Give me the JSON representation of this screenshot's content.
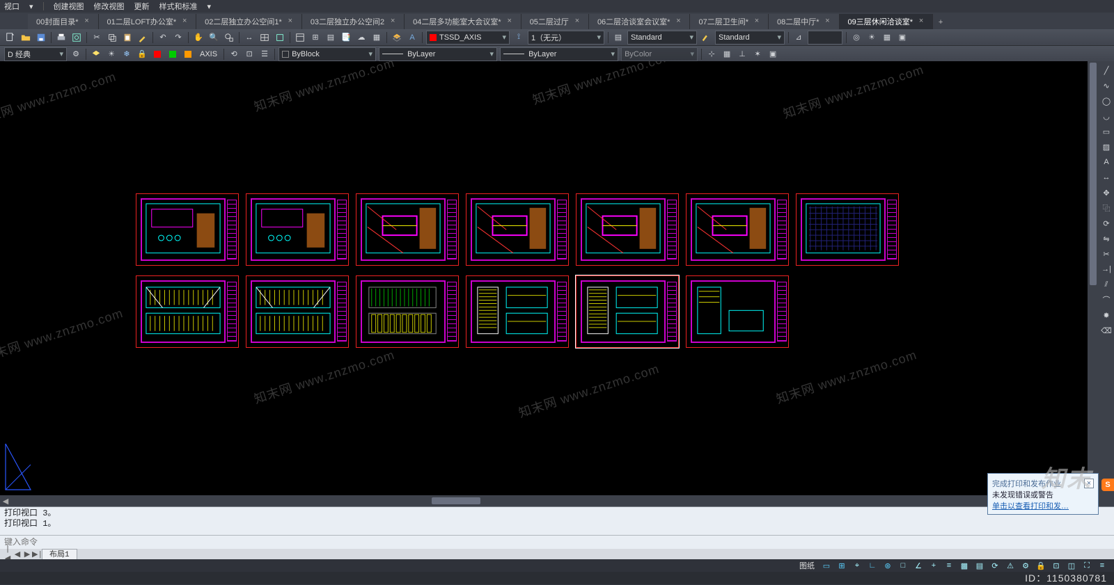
{
  "menu": {
    "items": [
      "视口",
      "创建视图",
      "修改视图",
      "更新",
      "样式和标准"
    ],
    "dropdown_glyph": "▾"
  },
  "tabs": [
    {
      "label": "00封面目录*"
    },
    {
      "label": "01二层LOFT办公室*"
    },
    {
      "label": "02二层独立办公空间1*"
    },
    {
      "label": "03二层独立办公空间2"
    },
    {
      "label": "04二层多功能室大会议室*"
    },
    {
      "label": "05二层过厅"
    },
    {
      "label": "06二层洽谈室会议室*"
    },
    {
      "label": "07二层卫生间*"
    },
    {
      "label": "08二层中厅*"
    },
    {
      "label": "09三层休闲洽谈室*",
      "active": true
    }
  ],
  "row1": {
    "layer_combo": "TSSD_AXIS",
    "lt_scale": "1（无元）",
    "text_style": "Standard",
    "dim_style": "Standard"
  },
  "row2": {
    "ws": "D 经典",
    "color": "ByBlock",
    "linetype": "ByLayer",
    "lineweight": "ByLayer",
    "plotstyle": "ByColor"
  },
  "cmd": {
    "log": [
      "打印视口 3。",
      "打印视口 1。"
    ],
    "prompt": "键入命令"
  },
  "layout": {
    "active": "布局1",
    "nav": [
      "|◀",
      "◀",
      "▶",
      "▶|"
    ]
  },
  "status": {
    "left": "",
    "paper_label": "图纸"
  },
  "popup": {
    "title": "完成打印和发布作业",
    "line1": "未发现错误或警告",
    "line2": "单击以查看打印和发…"
  },
  "brand": "知末",
  "id": "ID：1150380781",
  "watermark": "知末网 www.znzmo.com"
}
